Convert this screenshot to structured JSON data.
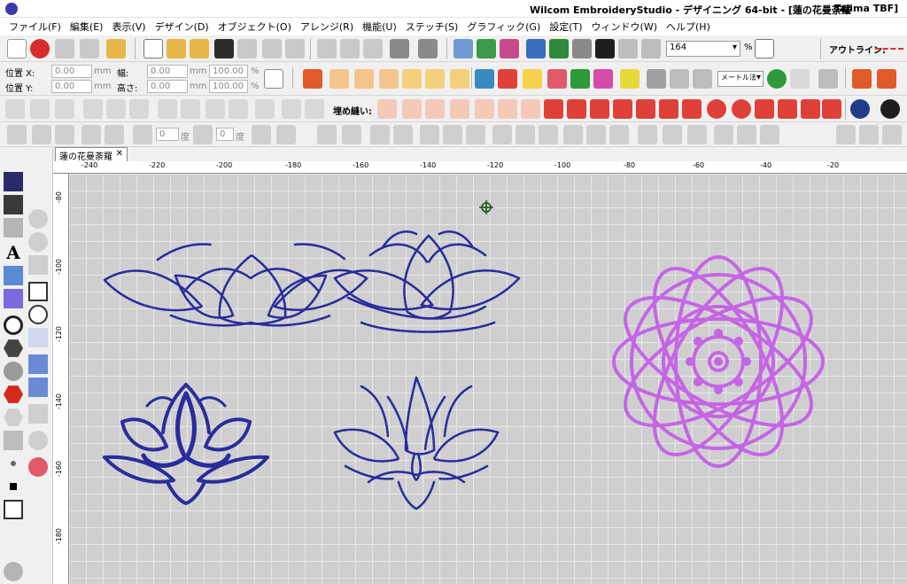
{
  "window": {
    "title": "Wilcom EmbroideryStudio - デザイニング 64-bit - [蓮の花曼荼羅",
    "subtitle": "Tajima TBF]"
  },
  "menu": [
    "ファイル(F)",
    "編集(E)",
    "表示(V)",
    "デザイン(D)",
    "オブジェクト(O)",
    "アレンジ(R)",
    "機能(U)",
    "ステッチ(S)",
    "グラフィック(G)",
    "設定(T)",
    "ウィンドウ(W)",
    "ヘルプ(H)"
  ],
  "toolbar": {
    "zoom_value": "164",
    "zoom_unit": "%",
    "outline_label": "アウトライン:"
  },
  "props": {
    "pos_x_label": "位置 X:",
    "pos_y_label": "位置 Y:",
    "pos_x": "0.00",
    "pos_y": "0.00",
    "width_label": "幅:",
    "height_label": "高さ:",
    "width": "0.00",
    "height": "0.00",
    "mm": "mm",
    "pct_w": "100.00",
    "pct_h": "100.00",
    "percent": "%",
    "unit_select": "メートル法",
    "fill_label": "埋め縫い:"
  },
  "rotate": {
    "value1": "0",
    "unit1": "度",
    "value2": "0",
    "unit2": "度"
  },
  "doc_tab": {
    "label": "蓮の花曼荼羅",
    "close": "✕"
  },
  "ruler": {
    "h": [
      "-240",
      "-220",
      "-200",
      "-180",
      "-160",
      "-140",
      "-120",
      "-100",
      "-80",
      "-60",
      "-40",
      "-20"
    ],
    "v": [
      "-80",
      "-100",
      "-120",
      "-140",
      "-160",
      "-180"
    ]
  },
  "colors": {
    "thread_blue": "#2a2c9c",
    "thread_violet": "#c565e6",
    "canvas": "#cfcfcf",
    "grid": "#e8e8e8",
    "accent_red": "#e03030"
  },
  "canvas": {
    "objects": [
      "lotus-outline-1",
      "lotus-outline-2",
      "lotus-satin-3",
      "lotus-outline-4",
      "flower-mandala-violet"
    ]
  }
}
